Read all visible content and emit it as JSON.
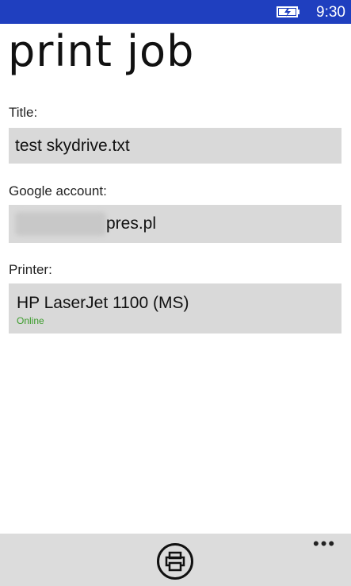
{
  "status_bar": {
    "time": "9:30",
    "battery_icon": "battery-charging-icon"
  },
  "page": {
    "title": "print job"
  },
  "fields": {
    "title": {
      "label": "Title:",
      "value": "test skydrive.txt"
    },
    "google_account": {
      "label": "Google account:",
      "value_visible_suffix": "pres.pl"
    },
    "printer": {
      "label": "Printer:",
      "name": "HP LaserJet 1100 (MS)",
      "status": "Online"
    }
  },
  "app_bar": {
    "print_icon": "print-icon",
    "more_icon": "more-icon",
    "more_label": "•••"
  },
  "colors": {
    "status_bar": "#1f3fbf",
    "field_bg": "#d9d9d9",
    "online": "#3a9b2a",
    "app_bar": "#dcdcdc"
  }
}
